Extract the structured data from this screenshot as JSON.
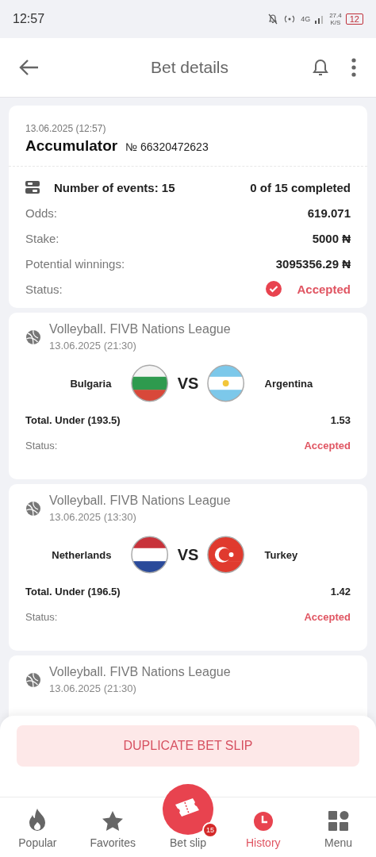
{
  "status_bar": {
    "time": "12:57",
    "net_type": "4G",
    "speed": "27.4",
    "speed_unit": "K/S",
    "battery": "12"
  },
  "header": {
    "title": "Bet details"
  },
  "bet": {
    "date": "13.06.2025 (12:57)",
    "type": "Accumulator",
    "number": "№ 66320472623",
    "events_label": "Number of events: 15",
    "completed": "0 of 15 completed",
    "rows": [
      {
        "label": "Odds:",
        "value": "619.071"
      },
      {
        "label": "Stake:",
        "value": "5000 ₦"
      },
      {
        "label": "Potential winnings:",
        "value": "3095356.29 ₦"
      }
    ],
    "status_label": "Status:",
    "status": "Accepted"
  },
  "events": [
    {
      "league": "Volleyball. FIVB Nations League",
      "date": "13.06.2025 (21:30)",
      "home": {
        "name": "Bulgaria",
        "kind": "bulgaria"
      },
      "vs": "VS",
      "away": {
        "name": "Argentina",
        "kind": "argentina"
      },
      "market": "Total. Under (193.5)",
      "odds": "1.53",
      "status_label": "Status:",
      "status": "Accepted"
    },
    {
      "league": "Volleyball. FIVB Nations League",
      "date": "13.06.2025 (13:30)",
      "home": {
        "name": "Netherlands",
        "kind": "netherlands"
      },
      "vs": "VS",
      "away": {
        "name": "Turkey",
        "kind": "turkey"
      },
      "market": "Total. Under (196.5)",
      "odds": "1.42",
      "status_label": "Status:",
      "status": "Accepted"
    },
    {
      "league": "Volleyball. FIVB Nations League",
      "date": "13.06.2025 (21:30)"
    }
  ],
  "duplicate_button": "DUPLICATE BET SLIP",
  "nav": [
    {
      "label": "Popular",
      "kind": "fire",
      "selected": false
    },
    {
      "label": "Favorites",
      "kind": "star",
      "selected": false
    },
    {
      "label": "Bet slip",
      "kind": "slip",
      "selected": false,
      "badge": "15"
    },
    {
      "label": "History",
      "kind": "clock",
      "selected": true
    },
    {
      "label": "Menu",
      "kind": "grid",
      "selected": false
    }
  ]
}
